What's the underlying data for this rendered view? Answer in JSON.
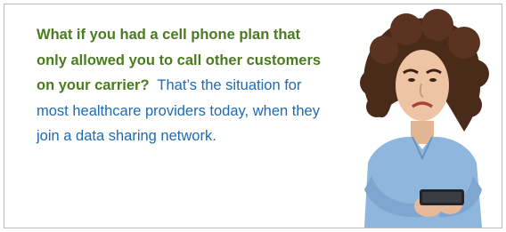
{
  "callout": {
    "question": "What if you had a cell phone plan that only allowed you to call other customers on your carrier?",
    "answer": "That’s the situation for most healthcare providers today, when they join a data sharing network."
  },
  "photo": {
    "subject": "woman frowning at smartphone",
    "icon": "person-photo"
  },
  "colors": {
    "question_text": "#4a7b1f",
    "answer_text": "#1f6ab3",
    "border": "#b9bdc2",
    "shirt": "#8fb6dc",
    "hair": "#4a2a18"
  }
}
